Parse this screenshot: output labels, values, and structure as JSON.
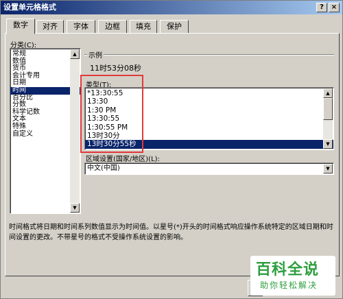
{
  "window": {
    "title": "设置单元格格式",
    "help": "?",
    "close": "×"
  },
  "tabs": [
    {
      "label": "数字"
    },
    {
      "label": "对齐"
    },
    {
      "label": "字体"
    },
    {
      "label": "边框"
    },
    {
      "label": "填充"
    },
    {
      "label": "保护"
    }
  ],
  "category": {
    "label": "分类(C):",
    "items": [
      "常规",
      "数值",
      "货币",
      "会计专用",
      "日期",
      "时间",
      "百分比",
      "分数",
      "科学记数",
      "文本",
      "特殊",
      "自定义"
    ],
    "selected_index": 5
  },
  "sample": {
    "label": "示例",
    "value": "11时53分08秒"
  },
  "type": {
    "label": "类型(T):",
    "items": [
      "*13:30:55",
      "13:30",
      "1:30 PM",
      "13:30:55",
      "1:30:55 PM",
      "13时30分",
      "13时30分55秒"
    ],
    "selected_index": 6
  },
  "locale": {
    "label": "区域设置(国家/地区)(L):",
    "value": "中文(中国)"
  },
  "description": "时间格式将日期和时间系列数值显示为时间值。以星号(*)开头的时间格式响应操作系统特定的区域日期和时间设置的更改。不带星号的格式不受操作系统设置的影响。",
  "watermark": {
    "big": "百科全说",
    "small": "助你轻松解决"
  },
  "accent": {
    "titlebar": "#0a246a",
    "selection": "#0a246a",
    "highlight": "#e23a3a",
    "watermark": "#2e9e3f"
  }
}
